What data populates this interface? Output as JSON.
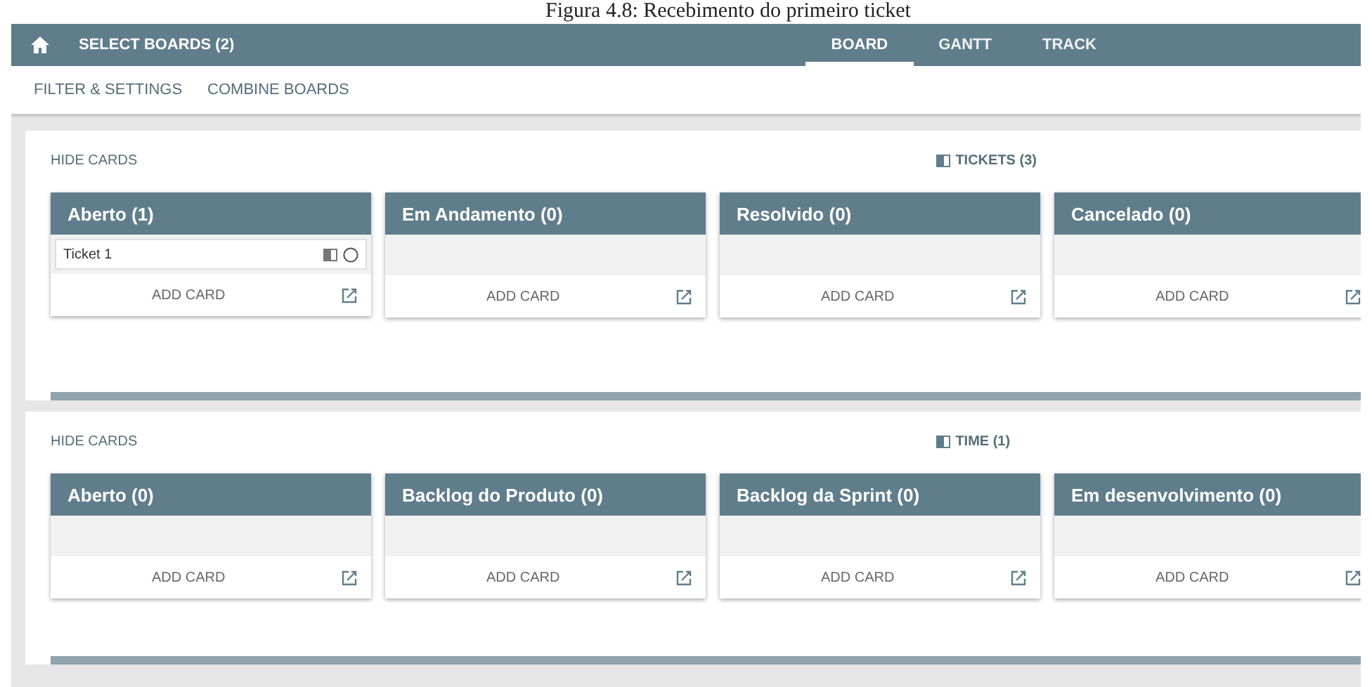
{
  "caption": "Figura 4.8: Recebimento do primeiro ticket",
  "app_bar": {
    "title": "SELECT BOARDS (2)",
    "tabs": [
      {
        "label": "BOARD",
        "selected": true
      },
      {
        "label": "GANTT",
        "selected": false
      },
      {
        "label": "TRACK",
        "selected": false
      }
    ]
  },
  "sub_bar": [
    "FILTER & SETTINGS",
    "COMBINE BOARDS"
  ],
  "boards": [
    {
      "hide_label": "HIDE CARDS",
      "title": "TICKETS (3)",
      "columns": [
        {
          "title": "Aberto (1)",
          "cards": [
            {
              "title": "Ticket 1"
            }
          ],
          "add_label": "ADD CARD"
        },
        {
          "title": "Em Andamento (0)",
          "add_label": "ADD CARD"
        },
        {
          "title": "Resolvido (0)",
          "add_label": "ADD CARD"
        },
        {
          "title": "Cancelado (0)",
          "add_label": "ADD CARD"
        }
      ]
    },
    {
      "hide_label": "HIDE CARDS",
      "title": "TIME (1)",
      "columns": [
        {
          "title": "Aberto (0)",
          "add_label": "ADD CARD"
        },
        {
          "title": "Backlog do Produto (0)",
          "add_label": "ADD CARD"
        },
        {
          "title": "Backlog da Sprint (0)",
          "add_label": "ADD CARD"
        },
        {
          "title": "Em desenvolvimento (0)",
          "add_label": "ADD CARD"
        }
      ]
    }
  ]
}
